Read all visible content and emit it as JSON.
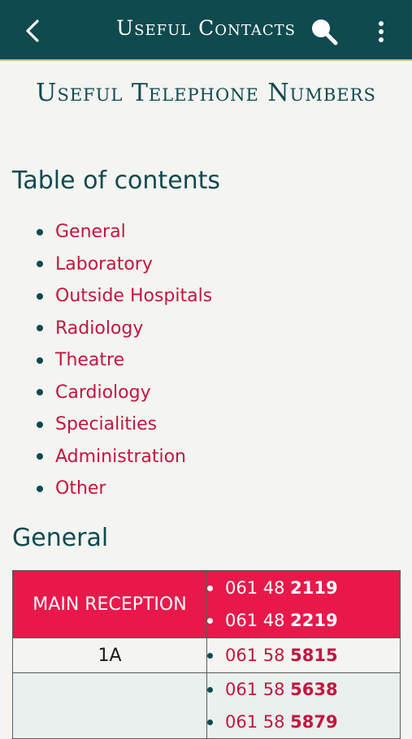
{
  "appbar": {
    "title": "Useful Contacts",
    "back_icon": "chevron-left-icon",
    "search_icon": "search-icon",
    "menu_icon": "more-vertical-icon"
  },
  "page": {
    "title": "Useful Telephone Numbers",
    "toc_heading": "Table of contents",
    "toc_items": [
      "General",
      "Laboratory",
      "Outside Hospitals",
      "Radiology",
      "Theatre",
      "Cardiology",
      "Specialities",
      "Administration",
      "Other"
    ],
    "section_heading": "General"
  },
  "contacts": [
    {
      "name": "MAIN RECEPTION",
      "numbers": [
        {
          "prefix": "061 48 ",
          "ext": "2119"
        },
        {
          "prefix": "061 48 ",
          "ext": "2219"
        }
      ]
    },
    {
      "name": "1A",
      "numbers": [
        {
          "prefix": "061 58 ",
          "ext": "5815"
        }
      ]
    },
    {
      "name": "",
      "numbers": [
        {
          "prefix": "061 58 ",
          "ext": "5638"
        },
        {
          "prefix": "061 58 ",
          "ext": "5879"
        }
      ]
    }
  ],
  "colors": {
    "header": "#0f4a4f",
    "accent": "#e8194a",
    "link": "#c3153f",
    "background": "#f4f4f1"
  }
}
